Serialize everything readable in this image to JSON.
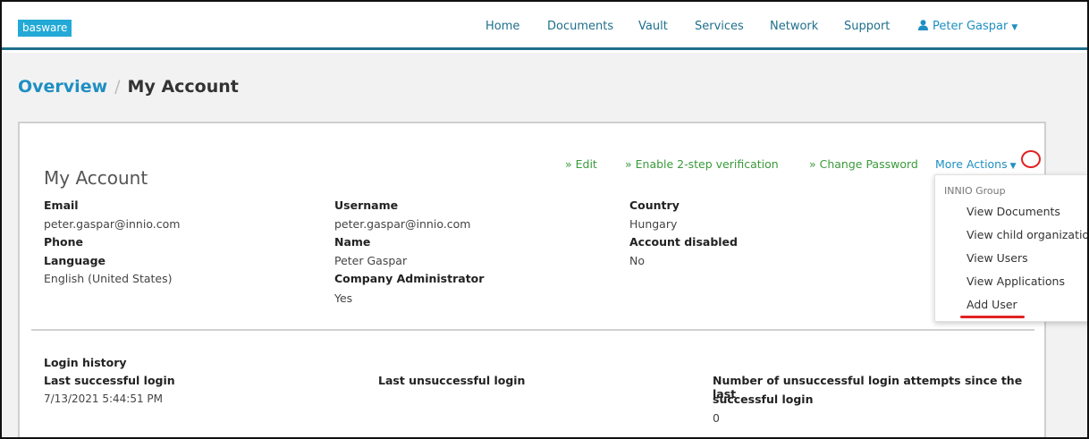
{
  "header": {
    "logo_text": "basware",
    "nav": [
      "Home",
      "Documents",
      "Vault",
      "Services",
      "Network",
      "Support"
    ],
    "user_name": "Peter Gaspar",
    "user_icon": "person-icon",
    "caret_icon": "caret-down-icon"
  },
  "breadcrumb": {
    "parent": "Overview",
    "separator": "/",
    "current": "My Account"
  },
  "card": {
    "title": "My Account",
    "actions": {
      "edit": "» Edit",
      "enable_2step": "» Enable 2-step verification",
      "change_password": "» Change Password",
      "more_actions": "More Actions"
    },
    "fields": {
      "email_label": "Email",
      "email_value": "peter.gaspar@innio.com",
      "phone_label": "Phone",
      "language_label": "Language",
      "language_value": "English (United States)",
      "username_label": "Username",
      "username_value": "peter.gaspar@innio.com",
      "name_label": "Name",
      "name_value": "Peter Gaspar",
      "company_admin_label": "Company Administrator",
      "company_admin_value": "Yes",
      "country_label": "Country",
      "country_value": "Hungary",
      "account_disabled_label": "Account disabled",
      "account_disabled_value": "No"
    },
    "login": {
      "section_title": "Login history",
      "last_success_label": "Last successful login",
      "last_success_value": "7/13/2021 5:44:51 PM",
      "last_unsuccess_label": "Last unsuccessful login",
      "attempts_label_line1": "Number of unsuccessful login attempts since the last",
      "attempts_label_line2": "successful login",
      "attempts_value": "0"
    }
  },
  "dropdown": {
    "header": "INNIO Group",
    "items": [
      "View Documents",
      "View child organizatio",
      "View Users",
      "View Applications",
      "Add User"
    ]
  },
  "colors": {
    "brand": "#23a9d6",
    "nav_link": "#1f6f8c",
    "action_green": "#3a9a3a",
    "annotation_red": "#e12222"
  }
}
